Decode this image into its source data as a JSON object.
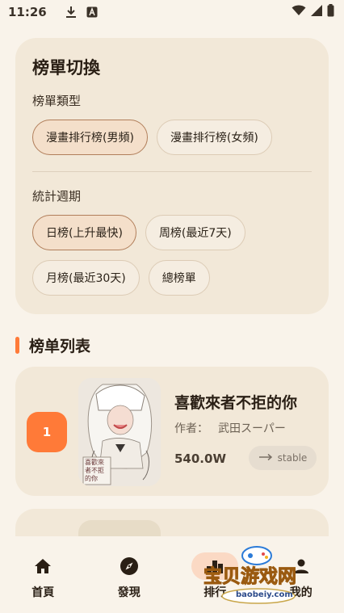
{
  "status_bar": {
    "time": "11:26",
    "icons": [
      "download-icon",
      "a-square-icon",
      "wifi-icon",
      "signal-icon",
      "battery-icon"
    ]
  },
  "switch_card": {
    "title": "榜單切換",
    "type_label": "榜單類型",
    "type_options": [
      "漫畫排行榜(男頻)",
      "漫畫排行榜(女頻)"
    ],
    "type_selected": "漫畫排行榜(男頻)",
    "period_label": "統計週期",
    "period_options": [
      "日榜(上升最快)",
      "周榜(最近7天)",
      "月榜(最近30天)",
      "總榜單"
    ],
    "period_selected": "日榜(上升最快)"
  },
  "list": {
    "heading": "榜单列表",
    "items": [
      {
        "rank": "1",
        "title": "喜歡來者不拒的你",
        "author_label": "作者：",
        "author": "武田スーパー",
        "views": "540.0W",
        "trend": "stable",
        "cover_text": "喜歡來者不拒的你"
      }
    ]
  },
  "bottom_nav": {
    "items": [
      {
        "label": "首頁",
        "icon": "home-icon"
      },
      {
        "label": "發現",
        "icon": "compass-icon"
      },
      {
        "label": "排行",
        "icon": "ranking-icon"
      },
      {
        "label": "我的",
        "icon": "person-icon"
      }
    ],
    "active_index": 2
  },
  "watermark": {
    "brand": "宝贝游戏网",
    "url": "baobeiy.com"
  },
  "colors": {
    "accent": "#ff7a38",
    "card_bg": "#f2e8d8",
    "page_bg": "#f9f3ea",
    "selected_chip_bg": "#f4dfca",
    "selected_chip_border": "#b17e5a"
  }
}
